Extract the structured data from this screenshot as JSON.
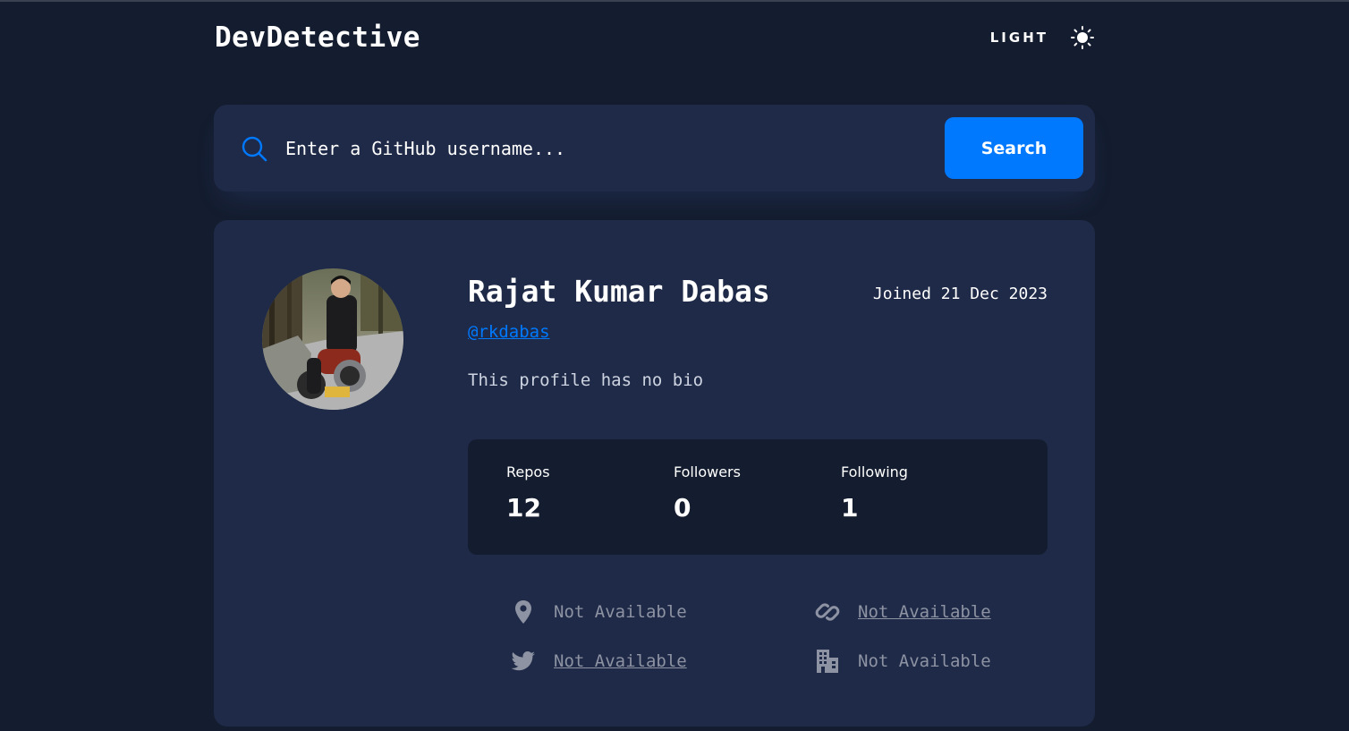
{
  "app": {
    "title": "DevDetective",
    "mode_label": "LIGHT",
    "mode_icon": "sun-icon"
  },
  "search": {
    "placeholder": "Enter a GitHub username...",
    "value": "",
    "button_label": "Search",
    "icon": "search-icon"
  },
  "profile": {
    "name": "Rajat Kumar Dabas",
    "joined": "Joined 21 Dec 2023",
    "username": "@rkdabas",
    "bio": "This profile has no bio",
    "stats": {
      "repos_label": "Repos",
      "repos_value": "12",
      "followers_label": "Followers",
      "followers_value": "0",
      "following_label": "Following",
      "following_value": "1"
    },
    "links": {
      "location": "Not Available",
      "blog": "Not Available",
      "twitter": "Not Available",
      "company": "Not Available"
    }
  },
  "colors": {
    "background": "#141d2f",
    "card": "#1e2a47",
    "accent": "#0079ff",
    "muted_text": "#8d93a3"
  }
}
